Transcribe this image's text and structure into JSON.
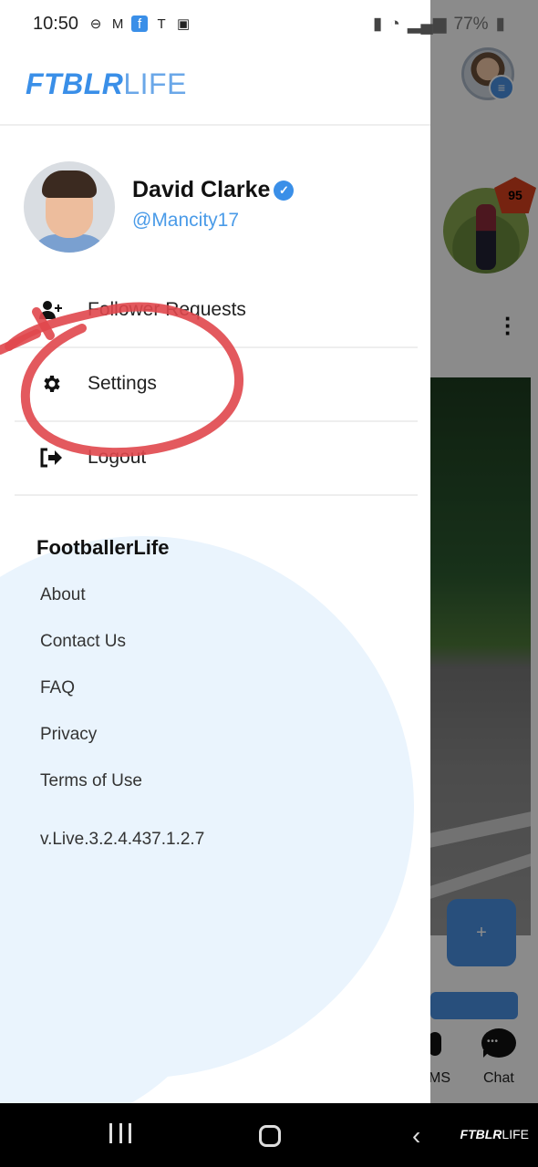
{
  "status_bar": {
    "time": "10:50",
    "battery": "77%"
  },
  "brand": {
    "bold": "FTBLR",
    "light": "LIFE",
    "accent_color": "#3a8fe8"
  },
  "profile": {
    "name": "David Clarke",
    "handle": "@Mancity17",
    "verified": true
  },
  "menu": [
    {
      "label": "Follower Requests",
      "icon": "add-user-icon"
    },
    {
      "label": "Settings",
      "icon": "gear-icon"
    },
    {
      "label": "Logout",
      "icon": "logout-icon"
    }
  ],
  "section": {
    "title": "FootballerLife",
    "links": [
      "About",
      "Contact Us",
      "FAQ",
      "Privacy",
      "Terms of Use"
    ],
    "version": "v.Live.3.2.4.437.1.2.7"
  },
  "background_app": {
    "rating": "95",
    "fab_label": "+",
    "nav_labels": [
      "MS",
      "Chat"
    ]
  },
  "watermark": {
    "bold": "FTBLR",
    "light": "LIFE"
  }
}
